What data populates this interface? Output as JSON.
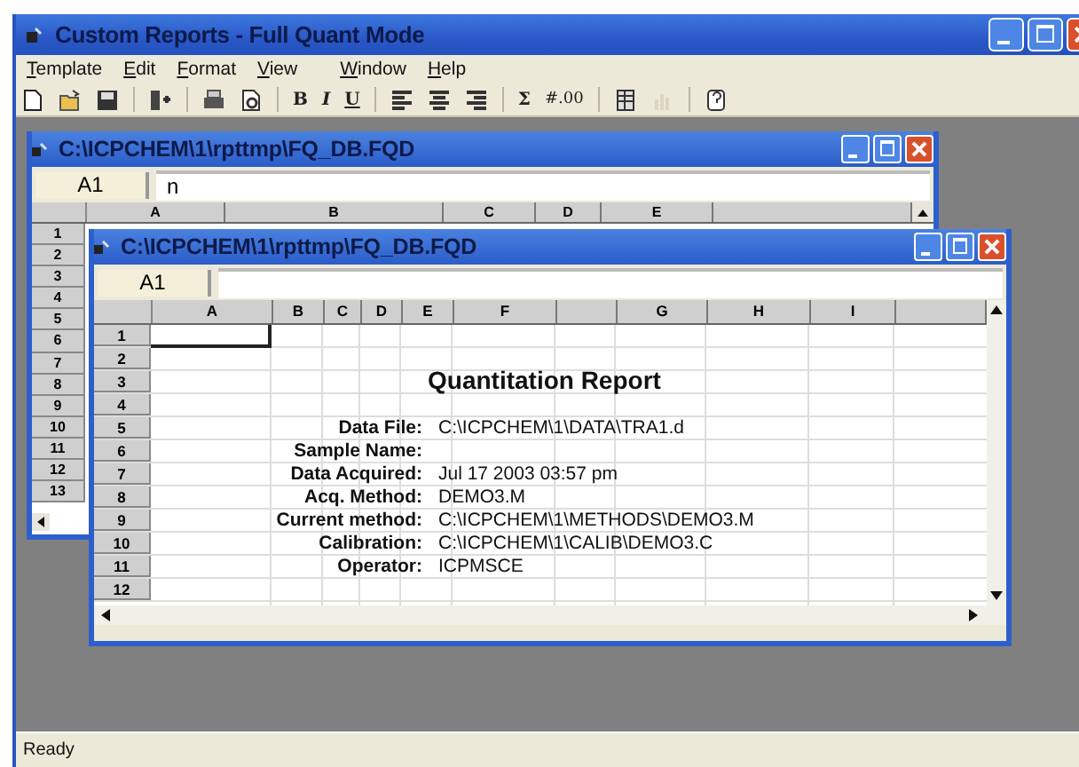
{
  "app_window": {
    "title": "Custom Reports - Full Quant Mode"
  },
  "menu": [
    "Template",
    "Edit",
    "Format",
    "View",
    "Window",
    "Help"
  ],
  "toolbar": [
    {
      "kind": "icon",
      "disabled": false
    },
    {
      "kind": "icon",
      "disabled": false
    },
    {
      "kind": "icon",
      "disabled": false
    },
    {
      "kind": "separator"
    },
    {
      "kind": "icon",
      "disabled": false
    },
    {
      "kind": "separator"
    },
    {
      "kind": "icon",
      "disabled": false
    },
    {
      "kind": "icon",
      "disabled": false
    },
    {
      "kind": "separator"
    },
    {
      "kind": "text",
      "label": "B"
    },
    {
      "kind": "text",
      "label": "I"
    },
    {
      "kind": "text",
      "label": "U"
    },
    {
      "kind": "separator"
    },
    {
      "kind": "icon",
      "disabled": false
    },
    {
      "kind": "icon",
      "disabled": false
    },
    {
      "kind": "icon",
      "disabled": false
    },
    {
      "kind": "separator"
    },
    {
      "kind": "text",
      "label": "Σ"
    },
    {
      "kind": "text",
      "label": "#.00"
    },
    {
      "kind": "separator"
    },
    {
      "kind": "icon",
      "disabled": false
    },
    {
      "kind": "icon",
      "disabled": true
    },
    {
      "kind": "separator"
    },
    {
      "kind": "icon",
      "disabled": false
    }
  ],
  "back_window": {
    "title": "C:\\ICPCHEM\\1\\rpttmp\\FQ_DB.FQD",
    "cell_ref": "A1",
    "formula": "n",
    "columns": [
      "A",
      "B",
      "C",
      "D",
      "E"
    ],
    "rows": [
      "1",
      "2",
      "3",
      "4",
      "5",
      "6",
      "7",
      "8",
      "9",
      "10",
      "11",
      "12",
      "13"
    ]
  },
  "front_window": {
    "title": "C:\\ICPCHEM\\1\\rpttmp\\FQ_DB.FQD",
    "cell_ref": "A1",
    "columns": [
      "A",
      "B",
      "C",
      "D",
      "E",
      "F",
      "G",
      "H",
      "I"
    ],
    "rows": [
      {
        "label": "1",
        "selected": true
      },
      {
        "label": "2",
        "selected": false
      },
      {
        "label": "3",
        "selected": false
      },
      {
        "label": "4",
        "selected": false
      },
      {
        "label": "5",
        "selected": false
      },
      {
        "label": "6",
        "selected": false
      },
      {
        "label": "7",
        "selected": false
      },
      {
        "label": "8",
        "selected": false
      },
      {
        "label": "9",
        "selected": false
      },
      {
        "label": "10",
        "selected": false
      },
      {
        "label": "11",
        "selected": false
      },
      {
        "label": "12",
        "selected": false
      }
    ],
    "report_title": "Quantitation Report",
    "fields": [
      {
        "label": "Data File:",
        "value": "C:\\ICPCHEM\\1\\DATA\\TRA1.d"
      },
      {
        "label": "Sample Name:"
      },
      {
        "label": "Data Acquired:",
        "value": "Jul 17 2003  03:57 pm"
      },
      {
        "label": "Acq. Method:",
        "value": "DEMO3.M"
      },
      {
        "label": "Current method:",
        "value": "C:\\ICPCHEM\\1\\METHODS\\DEMO3.M"
      },
      {
        "label": "Calibration:",
        "value": "C:\\ICPCHEM\\1\\CALIB\\DEMO3.C"
      },
      {
        "label": "Operator:",
        "value": "ICPMSCE"
      }
    ]
  },
  "status_bar": {
    "text": "Ready"
  }
}
